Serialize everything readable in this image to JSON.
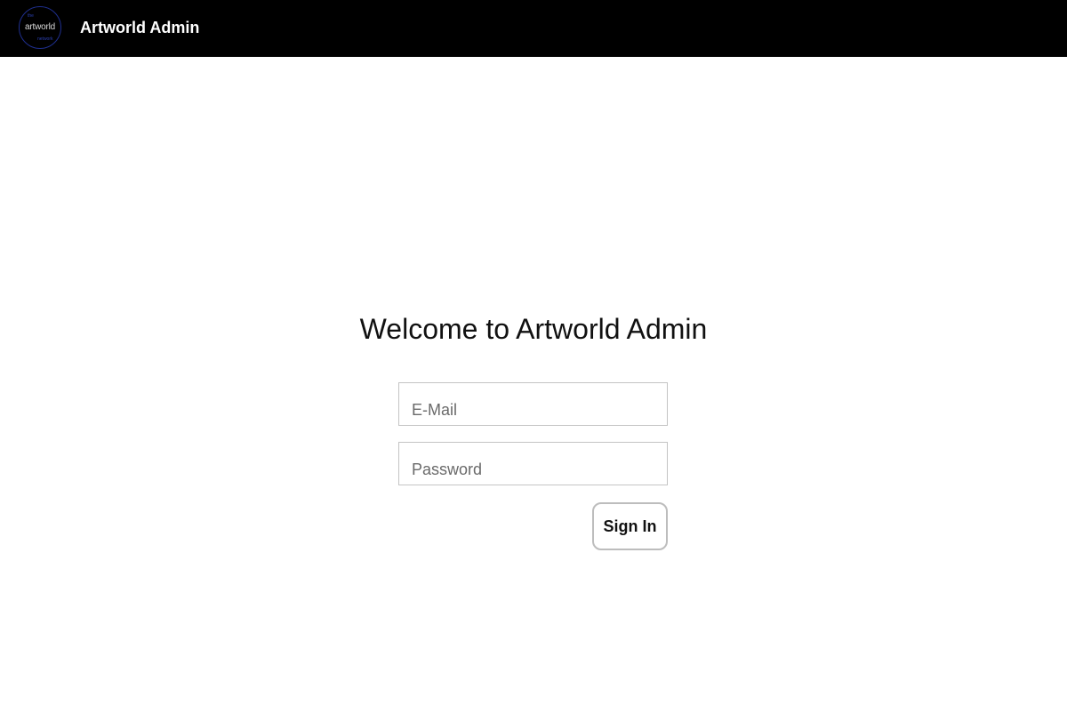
{
  "header": {
    "logo": {
      "top_text": "the",
      "main_text": "artworld",
      "bottom_text": "network",
      "ring_color": "#1f2f8f"
    },
    "title": "Artworld Admin",
    "background_color": "#000000"
  },
  "login": {
    "heading": "Welcome to Artworld Admin",
    "email_placeholder": "E-Mail",
    "email_value": "",
    "password_placeholder": "Password",
    "password_value": "",
    "submit_label": "Sign In"
  }
}
